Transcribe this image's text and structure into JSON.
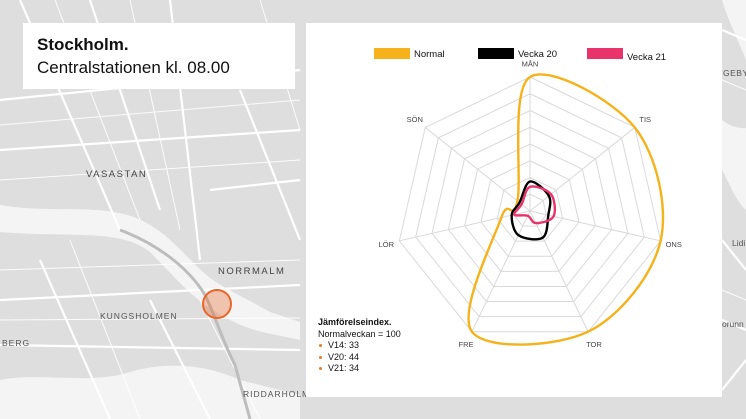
{
  "map": {
    "labels": [
      "VASASTAN",
      "NORRMALM",
      "KUNGSHOLMEN",
      "RIDDARHOLMEN",
      "BERG",
      "GEBY-L",
      "Lidi",
      "orunn"
    ]
  },
  "header": {
    "title": "Stockholm.",
    "subtitle": "Centralstationen kl. 08.00"
  },
  "colors": {
    "normal": "#f5b21a",
    "week20": "#000000",
    "week21": "#e8336b",
    "marker": "#e8662a"
  },
  "chart_data": {
    "type": "radar",
    "axes": [
      "MÅN",
      "TIS",
      "ONS",
      "TOR",
      "FRE",
      "LÖR",
      "SÖN"
    ],
    "rmax": 100,
    "rings": 8,
    "series": [
      {
        "name": "Normal",
        "values": [
          100,
          100,
          100,
          100,
          100,
          22,
          12
        ]
      },
      {
        "name": "Vecka 20",
        "values": [
          22,
          18,
          14,
          22,
          20,
          14,
          10
        ]
      },
      {
        "name": "Vecka 21",
        "values": [
          18,
          20,
          18,
          10,
          4,
          12,
          8
        ]
      }
    ]
  },
  "index": {
    "heading": "Jämförelseindex.",
    "base": "Normalveckan = 100",
    "items": [
      "V14: 33",
      "V20: 44",
      "V21: 34"
    ]
  }
}
